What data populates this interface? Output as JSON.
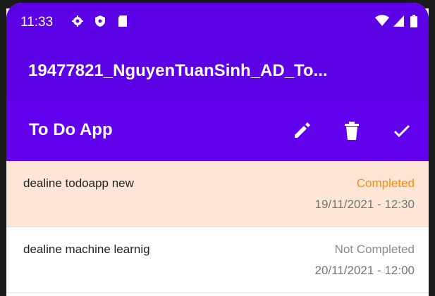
{
  "status_bar": {
    "time": "11:33",
    "icons": [
      "gear-icon",
      "shield-icon",
      "sd-card-icon",
      "wifi-icon",
      "signal-icon",
      "battery-icon"
    ]
  },
  "app_bar": {
    "title": "19477821_NguyenTuanSinh_AD_To..."
  },
  "toolbar": {
    "title": "To Do App",
    "actions": [
      "edit-icon",
      "delete-icon",
      "check-icon"
    ]
  },
  "todos": [
    {
      "title": "dealine todoapp new",
      "status": "Completed",
      "datetime": "19/11/2021 - 12:30",
      "selected": true,
      "status_color": "#ff8a00"
    },
    {
      "title": "dealine machine learnig",
      "status": "Not Completed",
      "datetime": "20/11/2021 - 12:00",
      "selected": false,
      "status_color": "#8a8a8a"
    }
  ],
  "colors": {
    "status_bar": "#5c00e6",
    "toolbar": "#6200ee",
    "selected_row": "#fde6d6"
  }
}
